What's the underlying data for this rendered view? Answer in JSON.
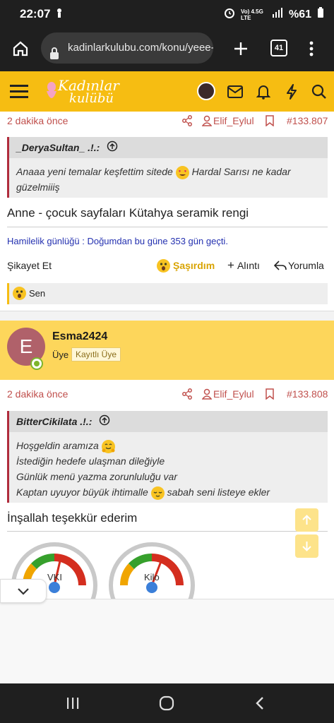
{
  "status": {
    "time": "22:07",
    "battery": "%61",
    "net": "Vo) 4.5G LTE"
  },
  "browser": {
    "url": "kadinlarkulubu.com/konu/yeee-",
    "tabs": "41"
  },
  "site": {
    "logo_line1": "Kadınlar",
    "logo_line2": "kulübü"
  },
  "post1": {
    "time": "2 dakika önce",
    "author_link": "Elif_Eylul",
    "post_no": "#133.807",
    "quote_author": "_DeryaSultan_ .!.:",
    "quote_text_a": "Anaaa yeni temalar keşfettim sitede",
    "quote_text_b": "Hardal Sarısı ne kadar",
    "quote_text_c": "güzelmiiiş",
    "body": "Anne - çocuk sayfaları Kütahya seramik rengi",
    "signature": "Hamilelik günlüğü : Doğumdan bu güne 353 gün geçti.",
    "report": "Şikayet Et",
    "reaction": "Şaşırdım",
    "quote_btn": "Alıntı",
    "reply_btn": "Yorumla",
    "reacted_by": "Sen"
  },
  "post2": {
    "avatar_letter": "E",
    "username": "Esma2424",
    "role": "Üye",
    "badge": "Kayıtlı Üye",
    "time": "2 dakika önce",
    "author_link": "Elif_Eylul",
    "post_no": "#133.808",
    "quote_author": "BitterCikilata .!.:",
    "quote_lines": [
      "Hoşgeldin aramıza",
      "İstediğin hedefe ulaşman dileğiyle",
      "Günlük menü yazma zorunluluğu var",
      "Kaptan uyuyor büyük ihtimalle",
      "sabah seni listeye ekler"
    ],
    "body": "İnşallah teşekkür ederim",
    "gauge1": "VKI",
    "gauge2": "Kilo"
  },
  "colors": {
    "accent": "#f6bd12",
    "link_red": "#c0504d",
    "post_header_bg": "#fdd65b"
  }
}
